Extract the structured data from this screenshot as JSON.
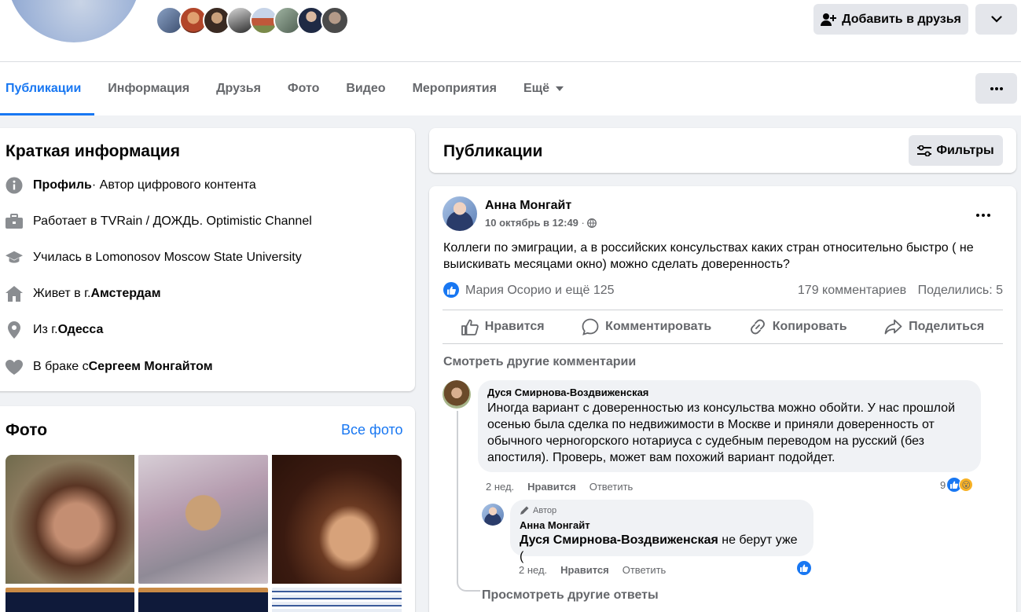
{
  "header": {
    "add_friend_label": "Добавить в друзья"
  },
  "tabs": [
    {
      "label": "Публикации"
    },
    {
      "label": "Информация"
    },
    {
      "label": "Друзья"
    },
    {
      "label": "Фото"
    },
    {
      "label": "Видео"
    },
    {
      "label": "Мероприятия"
    },
    {
      "label": "Ещё"
    }
  ],
  "intro": {
    "title": "Краткая информация",
    "profile_bold": "Профиль",
    "profile_rest": " · Автор цифрового контента",
    "work": "Работает в TVRain / ДОЖДЬ. Optimistic Channel",
    "education": "Училась в Lomonosov Moscow State University",
    "lives_prefix": "Живет в г. ",
    "lives_city": "Амстердам",
    "from_prefix": "Из г. ",
    "from_city": "Одесса",
    "married_prefix": "В браке с ",
    "married_name": "Сергеем Монгайтом"
  },
  "photos": {
    "title": "Фото",
    "all_label": "Все фото"
  },
  "publications": {
    "title": "Публикации",
    "filter_label": "Фильтры"
  },
  "post": {
    "author": "Анна Монгайт",
    "date": "10 октябрь в 12:49",
    "date_sep": " · ",
    "text": "Коллеги по эмиграции, а в российских консульствах каких стран относительно быстро ( не выискивать месяцами окно) можно сделать доверенность?",
    "reactions_text": "Мария Осорио и ещё 125",
    "comments_count": "179 комментариев",
    "shares": "Поделились: 5",
    "actions": {
      "like": "Нравится",
      "comment": "Комментировать",
      "copy": "Копировать",
      "share": "Поделиться"
    },
    "see_more_comments": "Смотреть другие комментарии"
  },
  "comments": [
    {
      "name": "Дуся Смирнова-Воздвиженская",
      "text": "Иногда вариант с доверенностью из консульства можно обойти. У нас прошлой осенью была сделка по недвижимости в Москве и приняли доверенность от обычного черногорского нотариуса с судебным переводом на русский (без апостиля). Проверь, может вам похожий вариант подойдет.",
      "time": "2 нед.",
      "like": "Нравится",
      "reply": "Ответить",
      "reaction_count": "9"
    }
  ],
  "reply": {
    "author_tag": "Автор",
    "name": "Анна Монгайт",
    "mention": "Дуся Смирнова-Воздвиженская",
    "text": " не берут уже (",
    "time": "2 нед.",
    "like": "Нравится",
    "reply": "Ответить"
  },
  "more_replies": "Просмотреть другие ответы",
  "colors": {
    "accent": "#1877f2",
    "secondary_text": "#65676b",
    "button_grey": "#e4e6eb"
  }
}
